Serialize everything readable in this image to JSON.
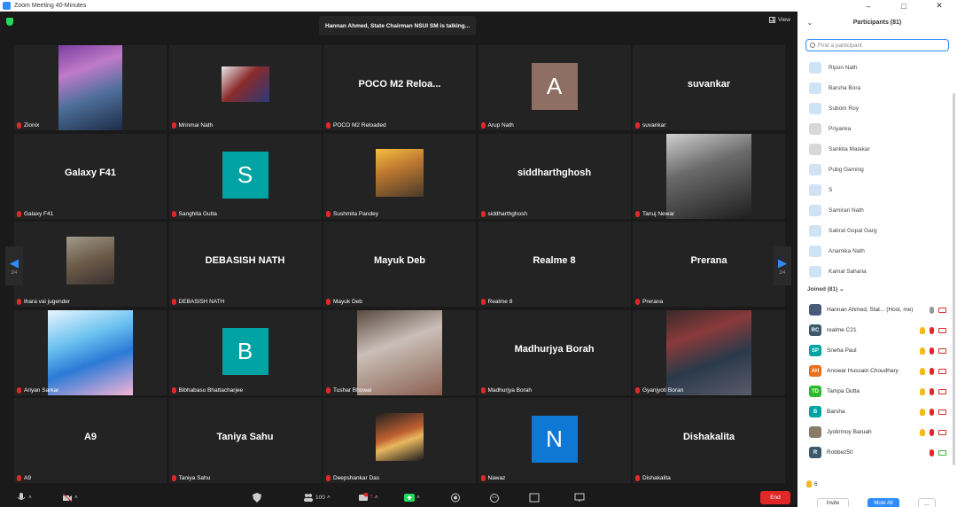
{
  "window": {
    "title": "Zoom Meeting 40-Minutes"
  },
  "meeting": {
    "talking": "Hannan Ahmed, State Chairman NSUI SM is talking...",
    "view_label": "View",
    "page_left": "2/4",
    "page_right": "2/4"
  },
  "tiles": [
    {
      "label": "Zionix",
      "big": "",
      "avatar": "",
      "color": ""
    },
    {
      "label": "Mrinmai Nath",
      "big": "",
      "avatar": "",
      "color": ""
    },
    {
      "label": "POCO M2 Reloaded",
      "big": "POCO M2 Reloa...",
      "avatar": "",
      "color": ""
    },
    {
      "label": "Arup Nath",
      "big": "",
      "avatar": "A",
      "color": "#8f6e63"
    },
    {
      "label": "suvankar",
      "big": "suvankar",
      "avatar": "",
      "color": ""
    },
    {
      "label": "Galaxy F41",
      "big": "Galaxy F41",
      "avatar": "",
      "color": ""
    },
    {
      "label": "Sanghita Gutta",
      "big": "",
      "avatar": "S",
      "color": "#00a3a3"
    },
    {
      "label": "Sushmita Pandey",
      "big": "",
      "avatar": "",
      "color": ""
    },
    {
      "label": "siddharthghosh",
      "big": "siddharthghosh",
      "avatar": "",
      "color": ""
    },
    {
      "label": "Tanuj Newar",
      "big": "",
      "avatar": "",
      "color": ""
    },
    {
      "label": "thara vai jugender",
      "big": "",
      "avatar": "",
      "color": ""
    },
    {
      "label": "DEBASISH NATH",
      "big": "DEBASISH NATH",
      "avatar": "",
      "color": ""
    },
    {
      "label": "Mayuk Deb",
      "big": "Mayuk Deb",
      "avatar": "",
      "color": ""
    },
    {
      "label": "Realme 8",
      "big": "Realme 8",
      "avatar": "",
      "color": ""
    },
    {
      "label": "Prerana",
      "big": "Prerana",
      "avatar": "",
      "color": ""
    },
    {
      "label": "Ariyan Sarkar",
      "big": "",
      "avatar": "",
      "color": ""
    },
    {
      "label": "Bibhabasu Bhattacharjee",
      "big": "",
      "avatar": "B",
      "color": "#00a3a3"
    },
    {
      "label": "Tushar Bhowal",
      "big": "",
      "avatar": "",
      "color": ""
    },
    {
      "label": "Madhurjya Borah",
      "big": "Madhurjya Borah",
      "avatar": "",
      "color": ""
    },
    {
      "label": "Gyanjyoti Boran",
      "big": "",
      "avatar": "",
      "color": ""
    },
    {
      "label": "A9",
      "big": "A9",
      "avatar": "",
      "color": ""
    },
    {
      "label": "Taniya Sahu",
      "big": "Taniya Sahu",
      "avatar": "",
      "color": ""
    },
    {
      "label": "Deepshankar Das",
      "big": "",
      "avatar": "",
      "color": ""
    },
    {
      "label": "Nawaz",
      "big": "",
      "avatar": "N",
      "color": "#0e78d4"
    },
    {
      "label": "Dishakalita",
      "big": "Dishakalita",
      "avatar": "",
      "color": ""
    }
  ],
  "toolbar": {
    "participants_count": "100",
    "chat_badge": "5",
    "end_label": "End"
  },
  "panel": {
    "title": "Participants (81)",
    "search_placeholder": "Find a participant",
    "waiting": [
      {
        "name": "Ripon Nath"
      },
      {
        "name": "Barsha Bora"
      },
      {
        "name": "Subom Roy"
      },
      {
        "name": "Priyanka"
      },
      {
        "name": "Sankita Malakar"
      },
      {
        "name": "Pubg Gaming"
      },
      {
        "name": "S"
      },
      {
        "name": "Samiran Nath"
      },
      {
        "name": "Sabrat Gopal Garg"
      },
      {
        "name": "Anamika Nath"
      },
      {
        "name": "Kamal Saharia"
      }
    ],
    "joined_label": "Joined (81)",
    "joined": [
      {
        "initials": "",
        "name": "Hannan Ahmed, Stat... (Host, me)",
        "color": "#4a5a7a",
        "hand": false,
        "mic": "on"
      },
      {
        "initials": "RC",
        "name": "realme C21",
        "color": "#3d5a6c",
        "hand": true,
        "mic": "off"
      },
      {
        "initials": "SP",
        "name": "Sneha Paul",
        "color": "#00a3a3",
        "hand": true,
        "mic": "off"
      },
      {
        "initials": "AH",
        "name": "Anowar Hussain Choudhary",
        "color": "#e8701a",
        "hand": true,
        "mic": "off"
      },
      {
        "initials": "TD",
        "name": "Tampa Dutta",
        "color": "#2eb82e",
        "hand": true,
        "mic": "off"
      },
      {
        "initials": "B",
        "name": "Barsha",
        "color": "#00a3a3",
        "hand": true,
        "mic": "off"
      },
      {
        "initials": "",
        "name": "Jyotirmoy Baruah",
        "color": "#8a7a6a",
        "hand": true,
        "mic": "off"
      },
      {
        "initials": "R",
        "name": "Robbez50",
        "color": "#3d5a6c",
        "hand": false,
        "mic": "off"
      }
    ],
    "hands_raised": "6",
    "invite_label": "Invite",
    "mute_all_label": "Mute All",
    "more_label": "..."
  }
}
